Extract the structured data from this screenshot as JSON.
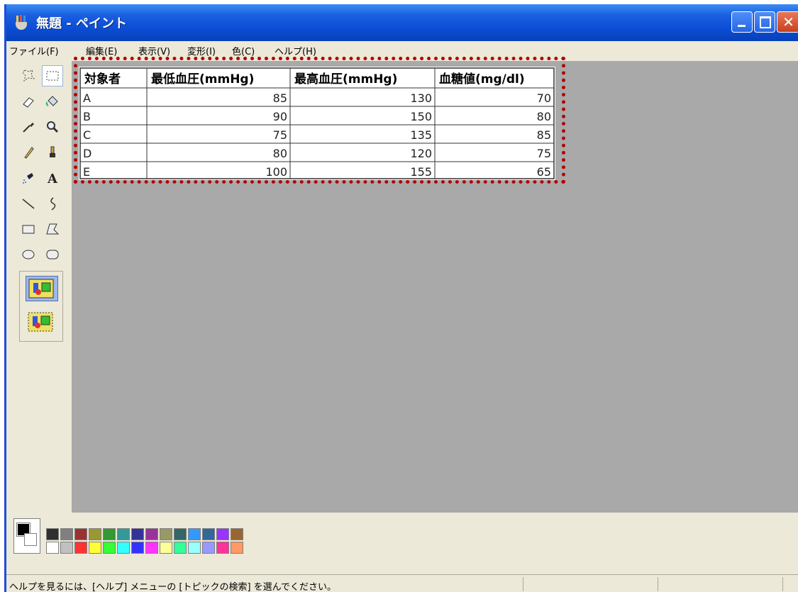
{
  "window": {
    "title": "無題 - ペイント",
    "close_glyph": "✕"
  },
  "menu": [
    "ファイル(F)",
    "編集(E)",
    "表示(V)",
    "変形(I)",
    "色(C)",
    "ヘルプ(H)"
  ],
  "tools": [
    "free-select-icon",
    "rect-select-icon",
    "eraser-icon",
    "fill-icon",
    "color-picker-icon",
    "magnifier-icon",
    "pencil-icon",
    "brush-icon",
    "airbrush-icon",
    "text-icon",
    "line-icon",
    "curve-icon",
    "rectangle-icon",
    "polygon-icon",
    "ellipse-icon",
    "rounded-rect-icon"
  ],
  "selected_tool": "rect-select-icon",
  "table": {
    "headers": [
      "対象者",
      "最低血圧(mmHg)",
      "最高血圧(mmHg)",
      "血糖値(mg/dl)"
    ],
    "rows": [
      [
        "A",
        "85",
        "130",
        "70"
      ],
      [
        "B",
        "90",
        "150",
        "80"
      ],
      [
        "C",
        "75",
        "135",
        "85"
      ],
      [
        "D",
        "80",
        "120",
        "75"
      ],
      [
        "E",
        "100",
        "155",
        "65"
      ]
    ]
  },
  "palette": {
    "foreground": "#000000",
    "background": "#ffffff",
    "row1": [
      "#303030",
      "#808080",
      "#993333",
      "#999933",
      "#339933",
      "#339999",
      "#333399",
      "#993399",
      "#999966",
      "#336666",
      "#3399ff",
      "#336699",
      "#9933ff",
      "#996633"
    ],
    "row2": [
      "#ffffff",
      "#c0c0c0",
      "#ff3333",
      "#ffff33",
      "#33ff33",
      "#33ffff",
      "#3333ff",
      "#ff33ff",
      "#ffff99",
      "#33ff99",
      "#99ffff",
      "#9999ff",
      "#ff3399",
      "#ff9966"
    ]
  },
  "status": {
    "text": "ヘルプを見るには、[ヘルプ] メニューの [トピックの検索] を選んでください。"
  },
  "colors": {
    "selection_border": "#b30000",
    "canvas_bg": "#a9a9a9",
    "titlebar": "#0a4bd3"
  }
}
